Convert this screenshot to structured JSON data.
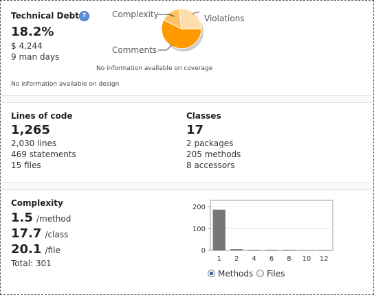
{
  "debt": {
    "title": "Technical Debt",
    "percent": "18.2%",
    "cost": "$ 4,244",
    "days": "9 man days",
    "coverage_note": "No information available on coverage",
    "design_note": "No information available on design",
    "help_icon": "question-icon",
    "pie": {
      "labels": {
        "complexity": "Complexity",
        "violations": "Violations",
        "comments": "Comments"
      },
      "colors": {
        "comments": "#ff9900",
        "violations": "#ffddaa",
        "complexity": "#ffc266"
      }
    }
  },
  "size": {
    "loc_title": "Lines of code",
    "loc_value": "1,265",
    "lines": "2,030 lines",
    "statements": "469 statements",
    "files": "15 files",
    "classes_title": "Classes",
    "classes_value": "17",
    "packages": "2 packages",
    "methods": "205 methods",
    "accessors": "8 accessors"
  },
  "complexity": {
    "title": "Complexity",
    "per_method": "1.5",
    "per_method_unit": "/method",
    "per_class": "17.7",
    "per_class_unit": "/class",
    "per_file": "20.1",
    "per_file_unit": "/file",
    "total": "Total: 301",
    "radio_methods": "Methods",
    "radio_files": "Files",
    "selected": "Methods"
  },
  "chart_data": {
    "type": "bar",
    "categories": [
      "1",
      "2",
      "4",
      "6",
      "8",
      "10",
      "12"
    ],
    "values": [
      187,
      6,
      3,
      3,
      3,
      1,
      2
    ],
    "yticks": [
      0,
      100,
      200
    ],
    "ylim": [
      0,
      230
    ],
    "bar_color": "#777777"
  }
}
